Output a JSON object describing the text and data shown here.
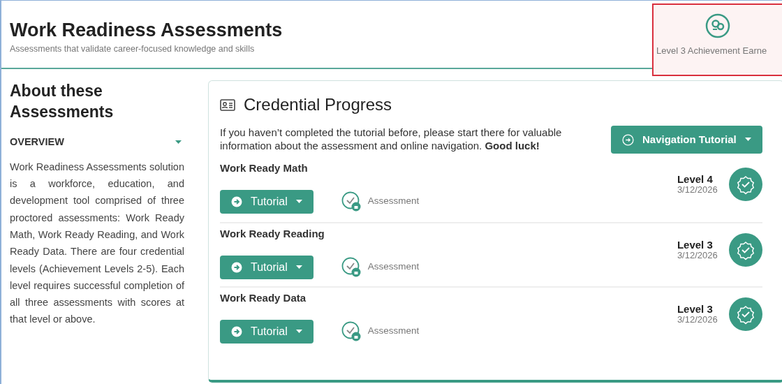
{
  "header": {
    "title": "Work Readiness Assessments",
    "subtitle": "Assessments that validate career-focused knowledge and skills"
  },
  "achievement": {
    "label": "Level 3 Achievement Earne",
    "highlighted": true
  },
  "about": {
    "title": "About these Assessments",
    "section": {
      "label": "OVERVIEW",
      "expanded": true,
      "text": "Work Readiness Assessments solution is a workforce, education, and development tool comprised of three proctored assessments: Work Ready Math, Work Ready Reading, and Work Ready Data. There are four credential levels (Achievement Levels 2-5). Each level requires successful completion of all three assessments with scores at that level or above."
    }
  },
  "progress": {
    "title": "Credential Progress",
    "intro": "If you haven’t completed the tutorial before, please start there for valuable information about the assessment and online navigation. **Good luck!**",
    "nav_button": "Navigation Tutorial",
    "assessments": [
      {
        "name": "Work Ready Math",
        "tutorial": "Tutorial",
        "assessment": "Assessment",
        "locked": true,
        "level": "Level 4",
        "date": "3/12/2026",
        "earned": true
      },
      {
        "name": "Work Ready Reading",
        "tutorial": "Tutorial",
        "assessment": "Assessment",
        "locked": true,
        "level": "Level 3",
        "date": "3/12/2026",
        "earned": true
      },
      {
        "name": "Work Ready Data",
        "tutorial": "Tutorial",
        "assessment": "Assessment",
        "locked": true,
        "level": "Level 3",
        "date": "3/12/2026",
        "earned": true
      }
    ]
  }
}
